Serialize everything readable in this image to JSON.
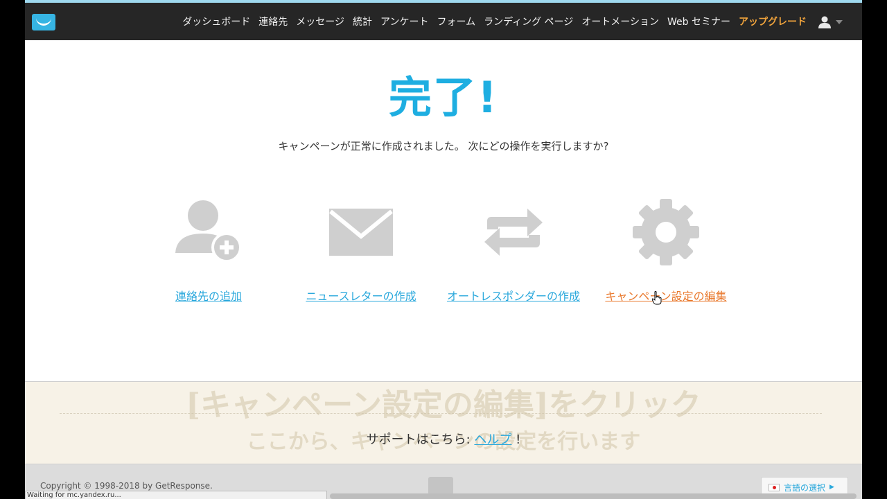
{
  "nav": {
    "items": [
      "ダッシュボード",
      "連絡先",
      "メッセージ",
      "統計",
      "アンケート",
      "フォーム",
      "ランディング ページ",
      "オートメーション",
      "Web セミナー"
    ],
    "upgrade": "アップグレード"
  },
  "header_icons": {
    "logo": "getresponse-logo-icon",
    "user": "user-icon",
    "dropdown": "caret-down-icon"
  },
  "main": {
    "title": "完了!",
    "subtitle": "キャンペーンが正常に作成されました。 次にどの操作を実行しますか?",
    "actions": [
      {
        "label": "連絡先の追加",
        "icon": "add-contact-icon"
      },
      {
        "label": "ニュースレターの作成",
        "icon": "envelope-icon"
      },
      {
        "label": "オートレスポンダーの作成",
        "icon": "repeat-icon"
      },
      {
        "label": "キャンペーン設定の編集",
        "icon": "gear-icon"
      }
    ]
  },
  "overlay": {
    "title": "[キャンペーン設定の編集]をクリック",
    "subtitle": "ここから、キャンペーンの設定を行います"
  },
  "support": {
    "text": "サポートはこちら: ",
    "link": "ヘルプ",
    "suffix": " !"
  },
  "footer": {
    "copyright": "Copyright © 1998-2018 by GetResponse.",
    "language": "言語の選択"
  },
  "status_bar": "Waiting for mc.yandex.ru...",
  "colors": {
    "accent": "#1eaee1",
    "link": "#2aa8dc",
    "highlight": "#e9782c",
    "upgrade": "#f1a43c",
    "topbar": "#262626"
  }
}
